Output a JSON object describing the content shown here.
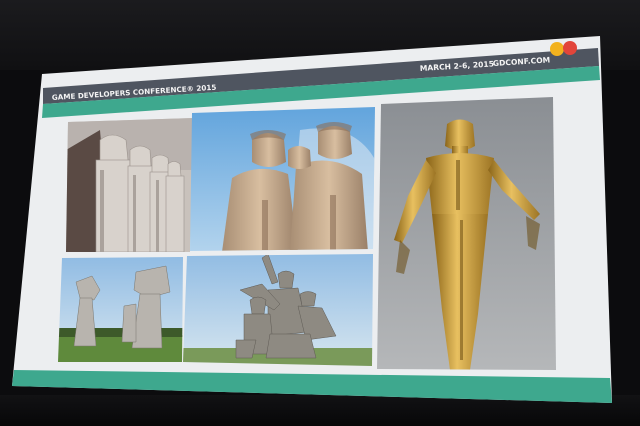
{
  "slide": {
    "date_text": "MARCH 2-6, 2015",
    "site_text": "GDCONF.COM",
    "conference_text": "GAME DEVELOPERS CONFERENCE® 2015",
    "colors": {
      "header_bar": "#4f5560",
      "accent_teal": "#3ea88e",
      "slide_bg": "#eceef0",
      "logo_yellow": "#f2b21e",
      "logo_red": "#e2453a"
    },
    "photos": [
      {
        "subject": "soldier-monument-relief"
      },
      {
        "subject": "sailor-statues"
      },
      {
        "subject": "gold-cosmonaut-statue"
      },
      {
        "subject": "abstract-stone-monuments"
      },
      {
        "subject": "soldier-group-statue"
      }
    ]
  }
}
